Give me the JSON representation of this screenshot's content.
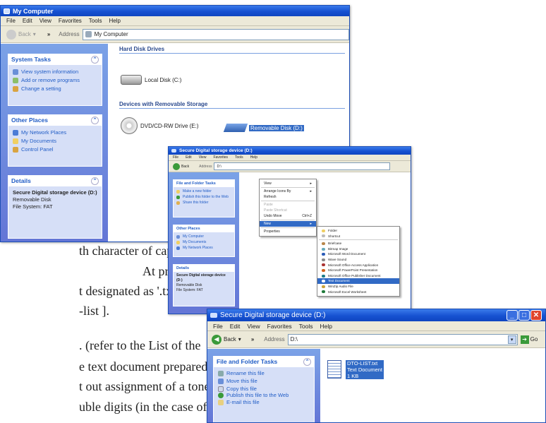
{
  "doc_text": {
    "line1": "th character of capital",
    "line2": "At preparation of a",
    "line3": "t designated as '.txt',",
    "line4": "-list ].",
    "line5": ". (refer to the List of the",
    "line6": "e text document prepared at",
    "line7": "t out assignment of a tone",
    "line8": "uble digits (in the case of a"
  },
  "win1": {
    "title": "My Computer",
    "menu": [
      "File",
      "Edit",
      "View",
      "Favorites",
      "Tools",
      "Help"
    ],
    "back_label": "Back",
    "address_label": "Address",
    "address_value": "My Computer",
    "system_tasks": {
      "title": "System Tasks",
      "items": [
        "View system information",
        "Add or remove programs",
        "Change a setting"
      ]
    },
    "other_places": {
      "title": "Other Places",
      "items": [
        "My Network Places",
        "My Documents",
        "Control Panel"
      ]
    },
    "details": {
      "title": "Details",
      "name": "Secure Digital storage device (D:)",
      "type": "Removable Disk",
      "fs": "File System: FAT"
    },
    "hdd_header": "Hard Disk Drives",
    "local_disk": "Local Disk (C:)",
    "removable_header": "Devices with Removable Storage",
    "dvd": "DVD/CD-RW Drive (E:)",
    "removable": "Removable Disk (D:)"
  },
  "win2": {
    "title": "Secure Digital storage device (D:)",
    "menu": [
      "File",
      "Edit",
      "View",
      "Favorites",
      "Tools",
      "Help"
    ],
    "back_label": "Back",
    "address_label": "Address",
    "address_value": "D:\\",
    "file_tasks": {
      "title": "File and Folder Tasks",
      "items": [
        "Make a new folder",
        "Publish this folder to the Web",
        "Share this folder"
      ]
    },
    "other_places": {
      "title": "Other Places",
      "items": [
        "My Computer",
        "My Documents",
        "My Network Places"
      ]
    },
    "details": {
      "title": "Details",
      "name": "Secure Digital storage device (D:)",
      "type": "Removable Disk",
      "fs": "File System: FAT"
    },
    "context_menu": [
      "View",
      "Arrange Icons By",
      "Refresh",
      "Paste",
      "Paste Shortcut",
      "Undo Move",
      "New",
      "Properties"
    ],
    "undo_shortcut": "Ctrl+Z",
    "new_submenu": [
      "Folder",
      "Shortcut",
      "Briefcase",
      "Bitmap Image",
      "Microsoft Word Document",
      "Wave Sound",
      "Microsoft Office Access Application",
      "Microsoft PowerPoint Presentation",
      "Microsoft Office Publisher Document",
      "Text Document",
      "WinZip Audio File",
      "Microsoft Excel Worksheet"
    ]
  },
  "win3": {
    "title": "Secure Digital storage device (D:)",
    "menu": [
      "File",
      "Edit",
      "View",
      "Favorites",
      "Tools",
      "Help"
    ],
    "back_label": "Back",
    "address_label": "Address",
    "address_value": "D:\\",
    "go_label": "Go",
    "file_tasks": {
      "title": "File and Folder Tasks",
      "items": [
        "Rename this file",
        "Move this file",
        "Copy this file",
        "Publish this file to the Web",
        "E-mail this file"
      ]
    },
    "file": {
      "name": "DTO-LIST.txt",
      "type": "Text Document",
      "size": "1 KB"
    }
  }
}
